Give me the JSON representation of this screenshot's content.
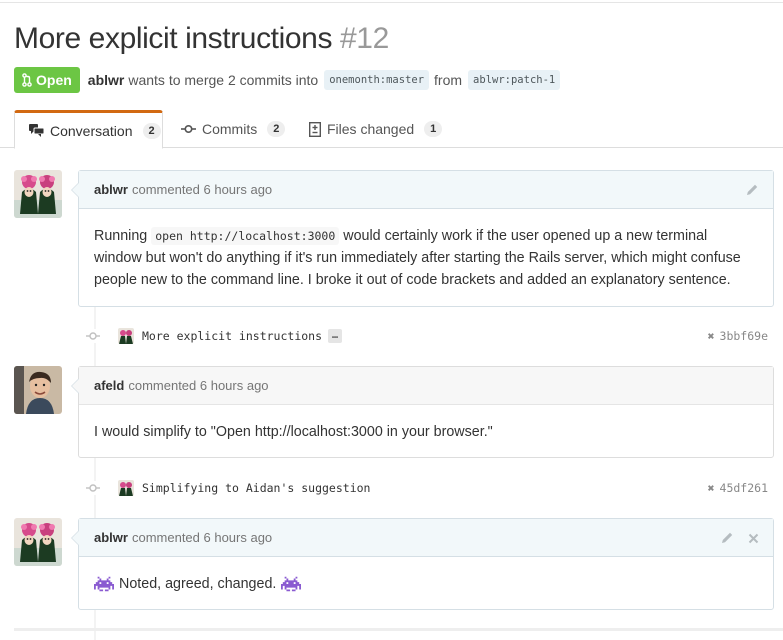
{
  "pr": {
    "title": "More explicit instructions",
    "number": "#12",
    "state": "Open",
    "author": "ablwr",
    "merge_text": "wants to merge 2 commits into",
    "base_branch": "onemonth:master",
    "from_text": "from",
    "head_branch": "ablwr:patch-1"
  },
  "tabs": [
    {
      "label": "Conversation",
      "count": "2",
      "icon": "comment-discussion-icon"
    },
    {
      "label": "Commits",
      "count": "2",
      "icon": "git-commit-icon"
    },
    {
      "label": "Files changed",
      "count": "1",
      "icon": "diff-icon"
    }
  ],
  "timeline": {
    "comment1": {
      "author": "ablwr",
      "meta": "commented 6 hours ago",
      "text_before": "Running",
      "code": "open http://localhost:3000",
      "text_after": "would certainly work if the user opened up a new terminal window but won't do anything if it's run immediately after starting the Rails server, which might confuse people new to the command line. I broke it out of code brackets and added an explanatory sentence."
    },
    "commit1": {
      "message": "More explicit instructions",
      "ellipsis": "…",
      "sha": "3bbf69e"
    },
    "comment2": {
      "author": "afeld",
      "meta": "commented 6 hours ago",
      "text": "I would simplify to \"Open http://localhost:3000 in your browser.\""
    },
    "commit2": {
      "message": "Simplifying to Aidan's suggestion",
      "sha": "45df261"
    },
    "comment3": {
      "author": "ablwr",
      "meta": "commented 6 hours ago",
      "text": "Noted, agreed, changed."
    }
  },
  "colors": {
    "open_green": "#6cc644",
    "tab_accent": "#d26911",
    "branch_bg": "#e8f1f6",
    "comment_header_bg": "#f2f8fa"
  }
}
